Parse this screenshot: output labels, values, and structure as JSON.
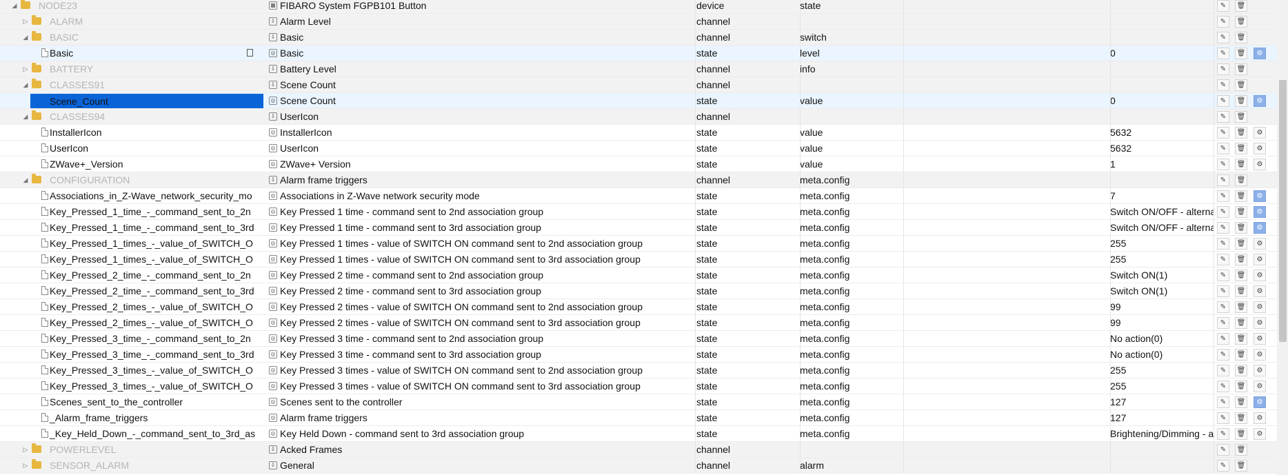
{
  "rows": [
    {
      "level": 0,
      "kind": "folder",
      "expanded": true,
      "dim": true,
      "id": "NODE23",
      "name": "FIBARO System FGPB101 Button",
      "name_icon": "device-icon",
      "type": "device",
      "role": "state",
      "value": "",
      "cfg": "none"
    },
    {
      "level": 1,
      "kind": "folder",
      "expanded": false,
      "dim": true,
      "id": "ALARM",
      "name": "Alarm Level",
      "name_icon": "channel-icon",
      "type": "channel",
      "role": "",
      "value": "",
      "cfg": "none"
    },
    {
      "level": 1,
      "kind": "folder",
      "expanded": true,
      "dim": true,
      "id": "BASIC",
      "name": "Basic",
      "name_icon": "channel-icon",
      "type": "channel",
      "role": "switch",
      "value": "",
      "cfg": "none"
    },
    {
      "level": 2,
      "kind": "state",
      "dim": false,
      "id": "Basic",
      "name": "Basic",
      "name_icon": "state-icon",
      "type": "state",
      "role": "level",
      "value": "0",
      "cfg": "active",
      "hover": true
    },
    {
      "level": 1,
      "kind": "folder",
      "expanded": false,
      "dim": true,
      "id": "BATTERY",
      "name": "Battery Level",
      "name_icon": "channel-icon",
      "type": "channel",
      "role": "info",
      "value": "",
      "cfg": "none"
    },
    {
      "level": 1,
      "kind": "folder",
      "expanded": true,
      "dim": true,
      "id": "CLASSES91",
      "name": "Scene Count",
      "name_icon": "channel-icon",
      "type": "channel",
      "role": "",
      "value": "",
      "cfg": "none"
    },
    {
      "level": 2,
      "kind": "state",
      "dim": false,
      "selected": true,
      "id": "Scene_Count",
      "name": "Scene Count",
      "name_icon": "state-icon",
      "type": "state",
      "role": "value",
      "value": "0",
      "cfg": "active"
    },
    {
      "level": 1,
      "kind": "folder",
      "expanded": true,
      "dim": true,
      "id": "CLASSES94",
      "name": "UserIcon",
      "name_icon": "channel-icon",
      "type": "channel",
      "role": "",
      "value": "",
      "cfg": "none"
    },
    {
      "level": 2,
      "kind": "state",
      "dim": false,
      "id": "InstallerIcon",
      "name": "InstallerIcon",
      "name_icon": "state-icon",
      "type": "state",
      "role": "value",
      "value": "5632",
      "cfg": "inactive"
    },
    {
      "level": 2,
      "kind": "state",
      "dim": false,
      "id": "UserIcon",
      "name": "UserIcon",
      "name_icon": "state-icon",
      "type": "state",
      "role": "value",
      "value": "5632",
      "cfg": "inactive"
    },
    {
      "level": 2,
      "kind": "state",
      "dim": false,
      "id": "ZWave+_Version",
      "name": "ZWave+ Version",
      "name_icon": "state-icon",
      "type": "state",
      "role": "value",
      "value": "1",
      "cfg": "inactive"
    },
    {
      "level": 1,
      "kind": "folder",
      "expanded": true,
      "dim": true,
      "id": "CONFIGURATION",
      "name": "Alarm frame triggers",
      "name_icon": "channel-icon",
      "type": "channel",
      "role": "meta.config",
      "value": "",
      "cfg": "none"
    },
    {
      "level": 2,
      "kind": "state",
      "dim": false,
      "id": "Associations_in_Z-Wave_network_security_mo",
      "name": "Associations in Z-Wave network security mode",
      "name_icon": "state-icon",
      "type": "state",
      "role": "meta.config",
      "value": "7",
      "cfg": "active"
    },
    {
      "level": 2,
      "kind": "state",
      "dim": false,
      "id": "Key_Pressed_1_time_-_command_sent_to_2n",
      "name": "Key Pressed 1 time - command sent to 2nd association group",
      "name_icon": "state-icon",
      "type": "state",
      "role": "meta.config",
      "value": "Switch ON/OFF - alterna",
      "cfg": "active"
    },
    {
      "level": 2,
      "kind": "state",
      "dim": false,
      "id": "Key_Pressed_1_time_-_command_sent_to_3rd",
      "name": "Key Pressed 1 time - command sent to 3rd association group",
      "name_icon": "state-icon",
      "type": "state",
      "role": "meta.config",
      "value": "Switch ON/OFF - alterna",
      "cfg": "active"
    },
    {
      "level": 2,
      "kind": "state",
      "dim": false,
      "id": "Key_Pressed_1_times_-_value_of_SWITCH_O",
      "name": "Key Pressed 1 times - value of SWITCH ON command sent to 2nd association group",
      "name_icon": "state-icon",
      "type": "state",
      "role": "meta.config",
      "value": "255",
      "cfg": "inactive"
    },
    {
      "level": 2,
      "kind": "state",
      "dim": false,
      "id": "Key_Pressed_1_times_-_value_of_SWITCH_O",
      "name": "Key Pressed 1 times - value of SWITCH ON command sent to 3rd association group",
      "name_icon": "state-icon",
      "type": "state",
      "role": "meta.config",
      "value": "255",
      "cfg": "inactive"
    },
    {
      "level": 2,
      "kind": "state",
      "dim": false,
      "id": "Key_Pressed_2_time_-_command_sent_to_2n",
      "name": "Key Pressed 2 time - command sent to 2nd association group",
      "name_icon": "state-icon",
      "type": "state",
      "role": "meta.config",
      "value": "Switch ON(1)",
      "cfg": "inactive"
    },
    {
      "level": 2,
      "kind": "state",
      "dim": false,
      "id": "Key_Pressed_2_time_-_command_sent_to_3rd",
      "name": "Key Pressed 2 time - command sent to 3rd association group",
      "name_icon": "state-icon",
      "type": "state",
      "role": "meta.config",
      "value": "Switch ON(1)",
      "cfg": "inactive"
    },
    {
      "level": 2,
      "kind": "state",
      "dim": false,
      "id": "Key_Pressed_2_times_-_value_of_SWITCH_O",
      "name": "Key Pressed 2 times - value of SWITCH ON command sent to 2nd association group",
      "name_icon": "state-icon",
      "type": "state",
      "role": "meta.config",
      "value": "99",
      "cfg": "inactive"
    },
    {
      "level": 2,
      "kind": "state",
      "dim": false,
      "id": "Key_Pressed_2_times_-_value_of_SWITCH_O",
      "name": "Key Pressed 2 times - value of SWITCH ON command sent to 3rd association group",
      "name_icon": "state-icon",
      "type": "state",
      "role": "meta.config",
      "value": "99",
      "cfg": "inactive"
    },
    {
      "level": 2,
      "kind": "state",
      "dim": false,
      "id": "Key_Pressed_3_time_-_command_sent_to_2n",
      "name": "Key Pressed 3 time - command sent to 2nd association group",
      "name_icon": "state-icon",
      "type": "state",
      "role": "meta.config",
      "value": "No action(0)",
      "cfg": "inactive"
    },
    {
      "level": 2,
      "kind": "state",
      "dim": false,
      "id": "Key_Pressed_3_time_-_command_sent_to_3rd",
      "name": "Key Pressed 3 time - command sent to 3rd association group",
      "name_icon": "state-icon",
      "type": "state",
      "role": "meta.config",
      "value": "No action(0)",
      "cfg": "inactive"
    },
    {
      "level": 2,
      "kind": "state",
      "dim": false,
      "id": "Key_Pressed_3_times_-_value_of_SWITCH_O",
      "name": "Key Pressed 3 times - value of SWITCH ON command sent to 2nd association group",
      "name_icon": "state-icon",
      "type": "state",
      "role": "meta.config",
      "value": "255",
      "cfg": "inactive"
    },
    {
      "level": 2,
      "kind": "state",
      "dim": false,
      "id": "Key_Pressed_3_times_-_value_of_SWITCH_O",
      "name": "Key Pressed 3 times - value of SWITCH ON command sent to 3rd association group",
      "name_icon": "state-icon",
      "type": "state",
      "role": "meta.config",
      "value": "255",
      "cfg": "inactive"
    },
    {
      "level": 2,
      "kind": "state",
      "dim": false,
      "id": "Scenes_sent_to_the_controller",
      "name": "Scenes sent to the controller",
      "name_icon": "state-icon",
      "type": "state",
      "role": "meta.config",
      "value": "127",
      "cfg": "active"
    },
    {
      "level": 2,
      "kind": "state",
      "dim": false,
      "id": "_Alarm_frame_triggers",
      "name": "Alarm frame triggers",
      "name_icon": "state-icon",
      "type": "state",
      "role": "meta.config",
      "value": "127",
      "cfg": "inactive"
    },
    {
      "level": 2,
      "kind": "state",
      "dim": false,
      "id": "_Key_Held_Down_-_command_sent_to_3rd_as",
      "name": "Key Held Down - command sent to 3rd association group",
      "name_icon": "state-icon",
      "type": "state",
      "role": "meta.config",
      "value": "Brightening/Dimming - a",
      "cfg": "inactive"
    },
    {
      "level": 1,
      "kind": "folder",
      "expanded": false,
      "dim": true,
      "id": "POWERLEVEL",
      "name": "Acked Frames",
      "name_icon": "channel-icon",
      "type": "channel",
      "role": "",
      "value": "",
      "cfg": "none"
    },
    {
      "level": 1,
      "kind": "folder",
      "expanded": false,
      "dim": true,
      "id": "SENSOR_ALARM",
      "name": "General",
      "name_icon": "channel-icon",
      "type": "channel",
      "role": "alarm",
      "value": "",
      "cfg": "none"
    }
  ],
  "icons": {
    "edit": "✎",
    "delete": "🗑",
    "config": "⚙",
    "device": "▦",
    "channel": "⇩",
    "state": "◎"
  }
}
